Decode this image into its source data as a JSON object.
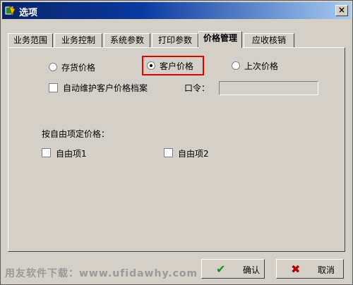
{
  "window": {
    "title": "选项",
    "close_label": "×"
  },
  "tabs": [
    {
      "label": "业务范围",
      "active": false
    },
    {
      "label": "业务控制",
      "active": false
    },
    {
      "label": "系统参数",
      "active": false
    },
    {
      "label": "打印参数",
      "active": false
    },
    {
      "label": "价格管理",
      "active": true
    },
    {
      "label": "应收核销",
      "active": false
    }
  ],
  "price": {
    "options": [
      {
        "label": "存货价格",
        "selected": false
      },
      {
        "label": "客户价格",
        "selected": true
      },
      {
        "label": "上次价格",
        "selected": false
      }
    ],
    "auto_maintain_label": "自动维护客户价格档案",
    "password_label": "口令：",
    "password_value": ""
  },
  "free_items": {
    "heading": "按自由项定价格：",
    "items": [
      {
        "label": "自由项1",
        "checked": false
      },
      {
        "label": "自由项2",
        "checked": false
      }
    ]
  },
  "buttons": {
    "ok": "确认",
    "cancel": "取消"
  },
  "watermark": "用友软件下载：www.ufidawhy.com",
  "colors": {
    "highlight": "#e00000",
    "ok_icon": "#1f8a1f",
    "cancel_icon": "#b00000"
  }
}
